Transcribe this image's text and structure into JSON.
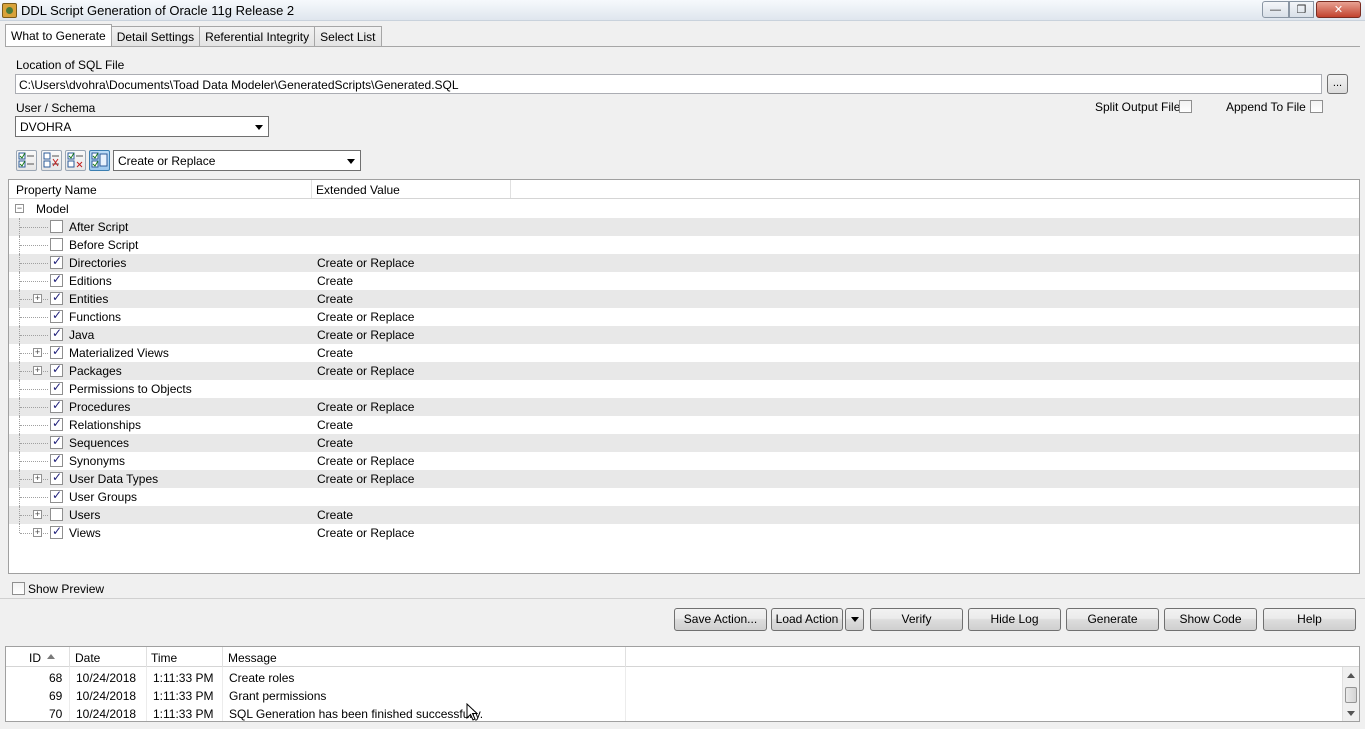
{
  "window": {
    "title": "DDL Script Generation of Oracle 11g Release 2",
    "min_glyph": "—",
    "max_glyph": "❐",
    "close_glyph": "✕"
  },
  "tabs": [
    {
      "label": "What to Generate",
      "active": true
    },
    {
      "label": "Detail Settings",
      "active": false
    },
    {
      "label": "Referential Integrity",
      "active": false
    },
    {
      "label": "Select List",
      "active": false
    }
  ],
  "location": {
    "label": "Location of SQL File",
    "value": "C:\\Users\\dvohra\\Documents\\Toad Data Modeler\\GeneratedScripts\\Generated.SQL",
    "browse_label": "..."
  },
  "schema": {
    "label": "User / Schema",
    "value": "DVOHRA"
  },
  "options": {
    "split_output_label": "Split Output File",
    "split_output_checked": false,
    "append_to_file_label": "Append To File",
    "append_to_file_checked": false
  },
  "action_select": {
    "value": "Create or Replace"
  },
  "toolbar_icons": [
    "check-all-icon",
    "uncheck-all-icon",
    "invert-check-icon",
    "check-selected-icon"
  ],
  "grid": {
    "headers": {
      "property": "Property Name",
      "value": "Extended Value"
    },
    "root": "Model",
    "rows": [
      {
        "name": "After Script",
        "value": "",
        "checked": false,
        "expandable": false
      },
      {
        "name": "Before Script",
        "value": "",
        "checked": false,
        "expandable": false
      },
      {
        "name": "Directories",
        "value": "Create or Replace",
        "checked": true,
        "expandable": false
      },
      {
        "name": "Editions",
        "value": "Create",
        "checked": true,
        "expandable": false
      },
      {
        "name": "Entities",
        "value": "Create",
        "checked": true,
        "expandable": true
      },
      {
        "name": "Functions",
        "value": "Create or Replace",
        "checked": true,
        "expandable": false
      },
      {
        "name": "Java",
        "value": "Create or Replace",
        "checked": true,
        "expandable": false
      },
      {
        "name": "Materialized Views",
        "value": "Create",
        "checked": true,
        "expandable": true
      },
      {
        "name": "Packages",
        "value": "Create or Replace",
        "checked": true,
        "expandable": true
      },
      {
        "name": "Permissions to Objects",
        "value": "",
        "checked": true,
        "expandable": false
      },
      {
        "name": "Procedures",
        "value": "Create or Replace",
        "checked": true,
        "expandable": false
      },
      {
        "name": "Relationships",
        "value": "Create",
        "checked": true,
        "expandable": false
      },
      {
        "name": "Sequences",
        "value": "Create",
        "checked": true,
        "expandable": false
      },
      {
        "name": "Synonyms",
        "value": "Create or Replace",
        "checked": true,
        "expandable": false
      },
      {
        "name": "User Data Types",
        "value": "Create or Replace",
        "checked": true,
        "expandable": true
      },
      {
        "name": "User Groups",
        "value": "",
        "checked": true,
        "expandable": false
      },
      {
        "name": "Users",
        "value": "Create",
        "checked": false,
        "expandable": true
      },
      {
        "name": "Views",
        "value": "Create or Replace",
        "checked": true,
        "expandable": true
      }
    ]
  },
  "show_preview": {
    "label": "Show Preview",
    "checked": false
  },
  "buttons": {
    "save_action": "Save Action...",
    "load_action": "Load Action",
    "verify": "Verify",
    "hide_log": "Hide Log",
    "generate": "Generate",
    "show_code": "Show Code",
    "help": "Help"
  },
  "log": {
    "headers": {
      "id": "ID",
      "date": "Date",
      "time": "Time",
      "message": "Message"
    },
    "rows": [
      {
        "id": "68",
        "date": "10/24/2018",
        "time": "1:11:33 PM",
        "message": "Create roles"
      },
      {
        "id": "69",
        "date": "10/24/2018",
        "time": "1:11:33 PM",
        "message": "Grant permissions"
      },
      {
        "id": "70",
        "date": "10/24/2018",
        "time": "1:11:33 PM",
        "message": "SQL Generation has been finished successfully."
      }
    ]
  }
}
